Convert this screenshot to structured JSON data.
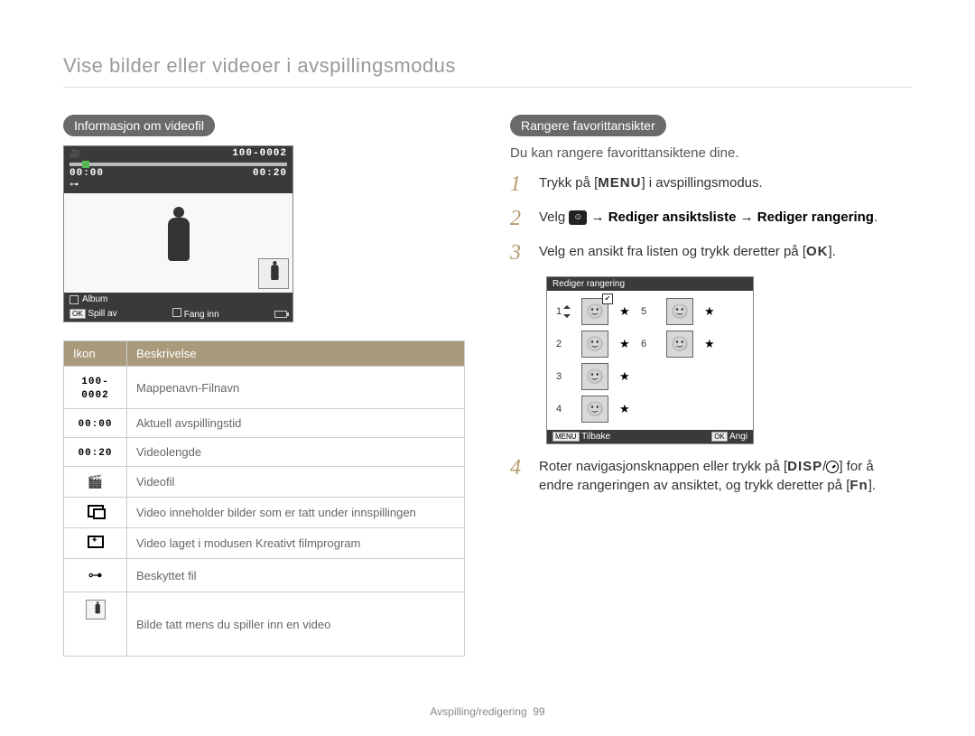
{
  "page": {
    "title": "Vise bilder eller videoer i avspillingsmodus",
    "footer_section": "Avspilling/redigering",
    "footer_page": "99"
  },
  "left": {
    "heading": "Informasjon om videofil",
    "screen": {
      "time_current": "00:00",
      "time_total": "00:20",
      "id": "100-0002",
      "album_label": "Album",
      "ok_label": "OK",
      "play_label": "Spill av",
      "capture_label": "Fang inn"
    },
    "table": {
      "header_icon": "Ikon",
      "header_desc": "Beskrivelse",
      "rows": [
        {
          "icon_text": "100-0002",
          "icon_class": "mono",
          "desc": "Mappenavn-Filnavn"
        },
        {
          "icon_text": "00:00",
          "icon_class": "mono",
          "desc": "Aktuell avspillingstid"
        },
        {
          "icon_text": "00:20",
          "icon_class": "mono",
          "desc": "Videolengde"
        },
        {
          "icon_text": "",
          "icon_class": "ic-video",
          "desc": "Videofil"
        },
        {
          "icon_text": "",
          "icon_class": "ic-inpic",
          "desc": "Video inneholder bilder som er tatt under innspillingen"
        },
        {
          "icon_text": "",
          "icon_class": "ic-creative",
          "desc": "Video laget i modusen Kreativt filmprogram"
        },
        {
          "icon_text": "",
          "icon_class": "ic-lock",
          "desc": "Beskyttet fil"
        },
        {
          "icon_text": "",
          "icon_class": "ic-thumb",
          "desc": "Bilde tatt mens du spiller inn en video"
        }
      ]
    }
  },
  "right": {
    "heading": "Rangere favorittansikter",
    "intro": "Du kan rangere favorittansiktene dine.",
    "steps": {
      "s1_a": "Trykk på [",
      "s1_btn": "MENU",
      "s1_b": "] i avspillingsmodus.",
      "s2_a": "Velg ",
      "s2_bold": " → Rediger ansiktsliste → Rediger rangering",
      "s2_b": ".",
      "s3_a": "Velg en ansikt fra listen og trykk deretter på [",
      "s3_btn": "OK",
      "s3_b": "].",
      "s4_a": "Roter navigasjonsknappen eller trykk på [",
      "s4_btn1": "DISP",
      "s4_sep": "/",
      "s4_b": "] for å endre rangeringen av ansiktet, og trykk deretter på [",
      "s4_btn2": "Fn",
      "s4_c": "]."
    },
    "face_screen": {
      "title": "Rediger rangering",
      "ranks_left": [
        "1",
        "2",
        "3",
        "4"
      ],
      "ranks_right": [
        "5",
        "6"
      ],
      "back_key": "MENU",
      "back_label": "Tilbake",
      "set_key": "OK",
      "set_label": "Angi"
    }
  }
}
